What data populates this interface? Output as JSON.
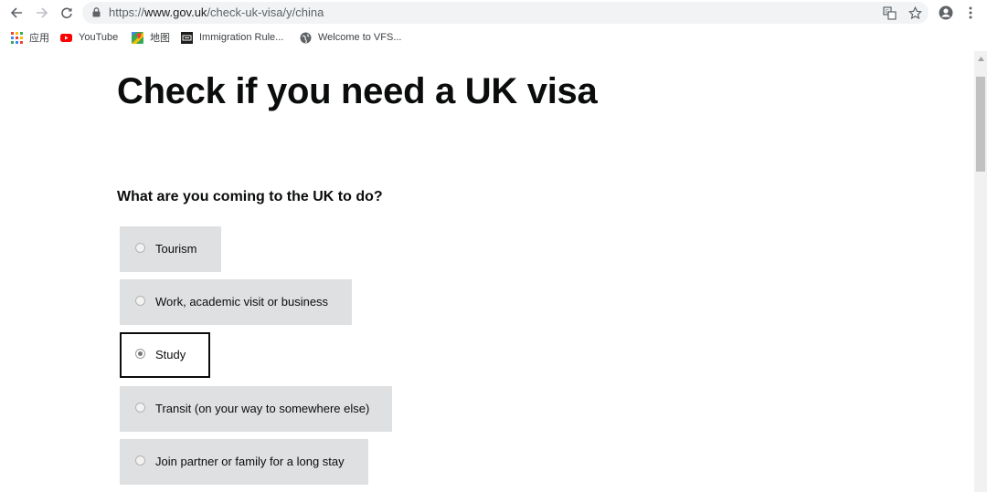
{
  "browser": {
    "url_scheme": "https://",
    "url_host": "www.gov.uk",
    "url_path": "/check-uk-visa/y/china",
    "icons": {
      "back": "arrow-left-icon",
      "forward": "arrow-right-icon",
      "reload": "reload-icon",
      "lock": "lock-icon",
      "translate": "translate-icon",
      "bookmark": "star-icon",
      "profile": "account-icon",
      "menu": "more-vertical-icon"
    }
  },
  "bookmarks": [
    {
      "label": "应用",
      "icon": "apps-grid-icon"
    },
    {
      "label": "YouTube",
      "icon": "youtube-icon"
    },
    {
      "label": "地图",
      "icon": "maps-icon"
    },
    {
      "label": "Immigration Rule...",
      "icon": "site-icon"
    },
    {
      "label": "Welcome to VFS...",
      "icon": "globe-icon"
    }
  ],
  "page": {
    "title": "Check if you need a UK visa",
    "question": "What are you coming to the UK to do?",
    "options": [
      {
        "label": "Tourism",
        "selected": false
      },
      {
        "label": "Work, academic visit or business",
        "selected": false
      },
      {
        "label": "Study",
        "selected": true
      },
      {
        "label": "Transit (on your way to somewhere else)",
        "selected": false
      },
      {
        "label": "Join partner or family for a long stay",
        "selected": false
      }
    ]
  },
  "colors": {
    "text": "#0b0c0c",
    "option_bg": "#dee0e2",
    "selected_border": "#0b0c0c",
    "omnibox_bg": "#f1f3f4"
  }
}
